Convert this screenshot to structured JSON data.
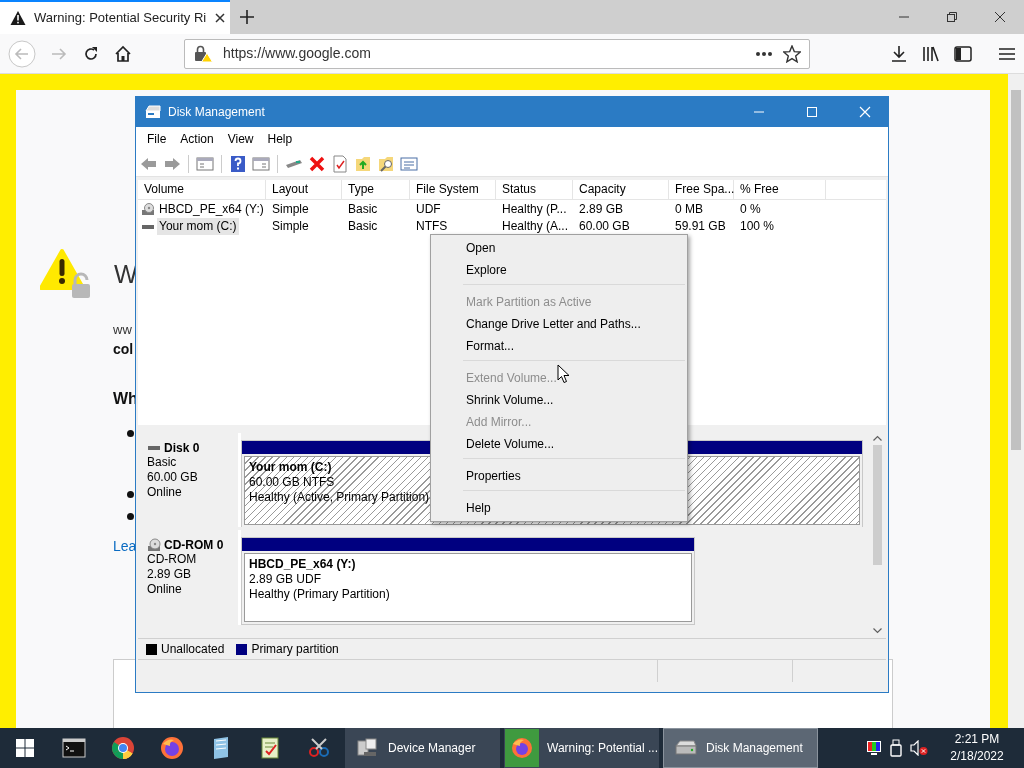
{
  "browser": {
    "tab": {
      "title": "Warning: Potential Security Ri",
      "selected": true
    },
    "url": "https://www.google.com"
  },
  "page": {
    "heading": "W",
    "blocks": [
      {
        "kind": "text",
        "text": "ww"
      },
      {
        "kind": "bold",
        "text": "col"
      },
      {
        "kind": "heading",
        "text": "Wh"
      },
      {
        "kind": "bullet"
      },
      {
        "kind": "bullet"
      },
      {
        "kind": "bullet"
      },
      {
        "kind": "link",
        "text": "Lea"
      }
    ]
  },
  "disk_management": {
    "title": "Disk Management",
    "menu": [
      "File",
      "Action",
      "View",
      "Help"
    ],
    "columns": [
      "Volume",
      "Layout",
      "Type",
      "File System",
      "Status",
      "Capacity",
      "Free Spa...",
      "% Free"
    ],
    "rows": [
      {
        "kind": "cdrom",
        "selected": false,
        "cells": [
          "HBCD_PE_x64 (Y:)",
          "Simple",
          "Basic",
          "UDF",
          "Healthy (P...",
          "2.89 GB",
          "0 MB",
          "0 %"
        ]
      },
      {
        "kind": "hdd",
        "selected": true,
        "cells": [
          "Your mom (C:)",
          "Simple",
          "Basic",
          "NTFS",
          "Healthy (A...",
          "60.00 GB",
          "59.91 GB",
          "100 %"
        ]
      }
    ],
    "disks": [
      {
        "kind": "hdd",
        "name": "Disk 0",
        "type": "Basic",
        "size": "60.00 GB",
        "status": "Online",
        "partition": {
          "title": "Your mom  (C:)",
          "detail": "60.00 GB NTFS",
          "status": "Healthy (Active, Primary Partition)",
          "selected": true,
          "color": "#000080"
        }
      },
      {
        "kind": "cdrom",
        "name": "CD-ROM 0",
        "type": "CD-ROM",
        "size": "2.89 GB",
        "status": "Online",
        "partition": {
          "title": "HBCD_PE_x64  (Y:)",
          "detail": "2.89 GB UDF",
          "status": "Healthy (Primary Partition)",
          "selected": false,
          "color": "#000080"
        }
      }
    ],
    "legend": [
      {
        "label": "Unallocated",
        "color": "#000000"
      },
      {
        "label": "Primary partition",
        "color": "#000080"
      }
    ]
  },
  "context_menu": [
    {
      "kind": "item",
      "label": "Open",
      "disabled": false
    },
    {
      "kind": "item",
      "label": "Explore",
      "disabled": false
    },
    {
      "kind": "separator"
    },
    {
      "kind": "item",
      "label": "Mark Partition as Active",
      "disabled": true
    },
    {
      "kind": "item",
      "label": "Change Drive Letter and Paths...",
      "disabled": false
    },
    {
      "kind": "item",
      "label": "Format...",
      "disabled": false
    },
    {
      "kind": "separator"
    },
    {
      "kind": "item",
      "label": "Extend Volume...",
      "disabled": true
    },
    {
      "kind": "item",
      "label": "Shrink Volume...",
      "disabled": false
    },
    {
      "kind": "item",
      "label": "Add Mirror...",
      "disabled": true
    },
    {
      "kind": "item",
      "label": "Delete Volume...",
      "disabled": false
    },
    {
      "kind": "separator"
    },
    {
      "kind": "item",
      "label": "Properties",
      "disabled": false
    },
    {
      "kind": "separator"
    },
    {
      "kind": "item",
      "label": "Help",
      "disabled": false
    }
  ],
  "taskbar": {
    "pinned": [
      {
        "kind": "terminal"
      },
      {
        "kind": "chrome"
      },
      {
        "kind": "firefox"
      },
      {
        "kind": "notepad"
      },
      {
        "kind": "checklist"
      },
      {
        "kind": "scissors"
      }
    ],
    "tasks": [
      {
        "kind": "device",
        "label": "Device Manager",
        "selected": false,
        "attention": false
      },
      {
        "kind": "firefox",
        "label": "Warning: Potential ...",
        "selected": false,
        "attention": true
      },
      {
        "kind": "disk",
        "label": "Disk Management",
        "selected": true,
        "attention": false
      }
    ],
    "time": "2:21 PM",
    "date": "2/18/2022"
  }
}
